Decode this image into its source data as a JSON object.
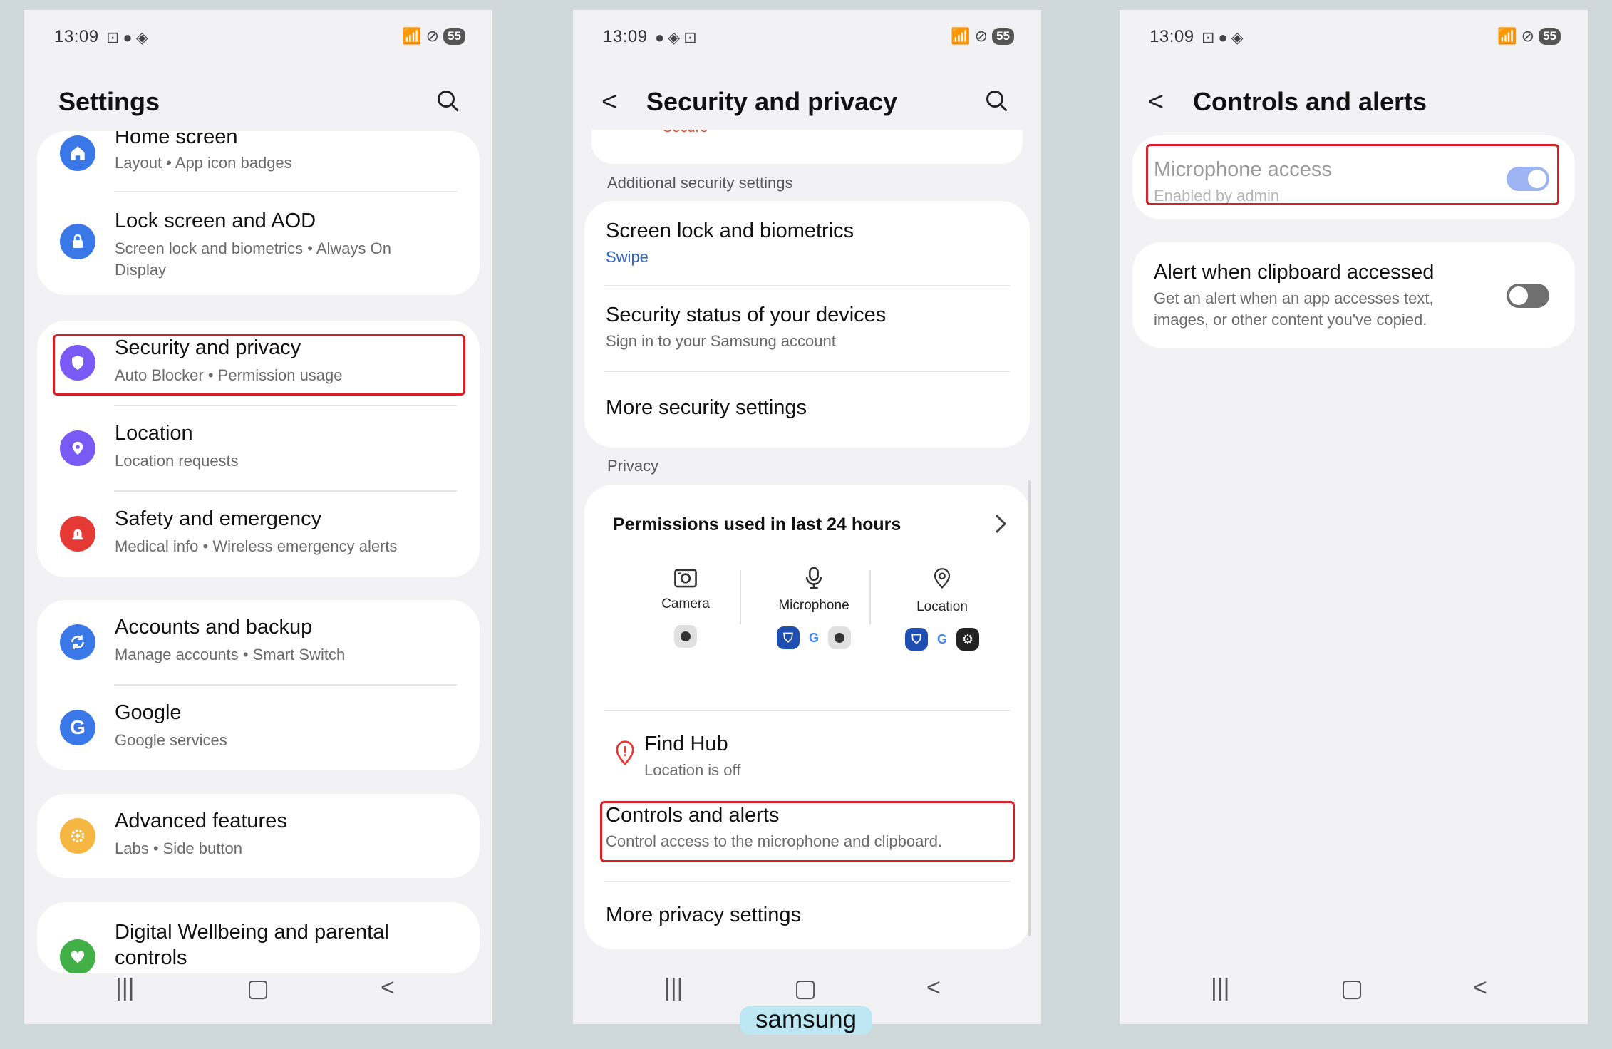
{
  "status": {
    "time": "13:09",
    "battery": "55"
  },
  "screen1": {
    "title": "Settings",
    "rows": [
      {
        "title": "Home screen",
        "subtitle": "Layout  •  App icon badges",
        "icon": "home-icon",
        "color": "#3b78e7"
      },
      {
        "title": "Lock screen and AOD",
        "subtitle": "Screen lock and biometrics  •  Always On Display",
        "icon": "lock-icon",
        "color": "#3b78e7"
      },
      {
        "title": "Security and privacy",
        "subtitle": "Auto Blocker  •  Permission usage",
        "icon": "shield-icon",
        "color": "#7a5af5"
      },
      {
        "title": "Location",
        "subtitle": "Location requests",
        "icon": "location-pin-icon",
        "color": "#7a5af5"
      },
      {
        "title": "Safety and emergency",
        "subtitle": "Medical info  •  Wireless emergency alerts",
        "icon": "siren-icon",
        "color": "#e53935"
      },
      {
        "title": "Accounts and backup",
        "subtitle": "Manage accounts  •  Smart Switch",
        "icon": "sync-icon",
        "color": "#3b78e7"
      },
      {
        "title": "Google",
        "subtitle": "Google services",
        "icon": "google-g-icon",
        "color": "#3b78e7"
      },
      {
        "title": "Advanced features",
        "subtitle": "Labs  •  Side button",
        "icon": "gear-plus-icon",
        "color": "#f5b642"
      },
      {
        "title": "Digital Wellbeing and parental controls",
        "subtitle": "",
        "icon": "heart-icon",
        "color": "#43b047"
      }
    ]
  },
  "screen2": {
    "title": "Security and privacy",
    "partial_top": "Secure",
    "additional_label": "Additional security settings",
    "additional": [
      {
        "title": "Screen lock and biometrics",
        "subtitle": "Swipe"
      },
      {
        "title": "Security status of your devices",
        "subtitle": "Sign in to your Samsung account"
      },
      {
        "title": "More security settings",
        "subtitle": ""
      }
    ],
    "privacy_label": "Privacy",
    "permissions_title": "Permissions used in last 24 hours",
    "permissions": [
      {
        "label": "Camera",
        "icon": "camera-icon"
      },
      {
        "label": "Microphone",
        "icon": "microphone-icon"
      },
      {
        "label": "Location",
        "icon": "location-pin-icon"
      }
    ],
    "find_hub": {
      "title": "Find Hub",
      "subtitle": "Location is off"
    },
    "controls": {
      "title": "Controls and alerts",
      "subtitle": "Control access to the microphone and clipboard."
    },
    "more_privacy": "More privacy settings"
  },
  "screen3": {
    "title": "Controls and alerts",
    "mic": {
      "title": "Microphone access",
      "subtitle": "Enabled by admin",
      "enabled": true
    },
    "clipboard": {
      "title": "Alert when clipboard accessed",
      "subtitle": "Get an alert when an app accesses text, images, or other content you've copied.",
      "enabled": false
    }
  },
  "brand": "samsung",
  "colors": {
    "highlight": "#d81f26",
    "link_blue": "#2f63c8",
    "toggle_on": "#9cb4f2",
    "toggle_off": "#6f6f6f"
  }
}
